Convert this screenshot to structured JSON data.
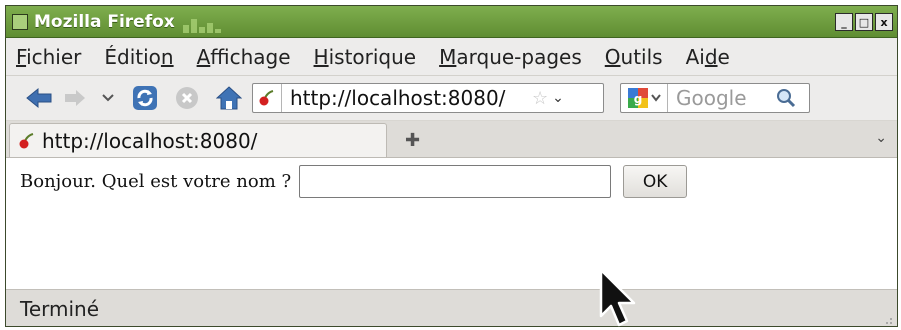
{
  "window": {
    "title": "Mozilla Firefox",
    "controls": [
      "_",
      "□",
      "x"
    ]
  },
  "menu": {
    "items": [
      {
        "pre": "",
        "u": "F",
        "post": "ichier"
      },
      {
        "pre": "Éditio",
        "u": "n",
        "post": ""
      },
      {
        "pre": "",
        "u": "A",
        "post": "ffichage"
      },
      {
        "pre": "",
        "u": "H",
        "post": "istorique"
      },
      {
        "pre": "",
        "u": "M",
        "post": "arque-pages"
      },
      {
        "pre": "",
        "u": "O",
        "post": "utils"
      },
      {
        "pre": "Ai",
        "u": "d",
        "post": "e"
      }
    ]
  },
  "toolbar": {
    "url": "http://localhost:8080/",
    "search_placeholder": "Google",
    "icons": [
      "back-arrow-icon",
      "forward-arrow-icon",
      "history-dropdown-icon",
      "reload-icon",
      "stop-icon",
      "home-icon",
      "bookmark-star-icon",
      "search-magnifier-icon"
    ]
  },
  "tabs": [
    {
      "label": "http://localhost:8080/",
      "active": true
    }
  ],
  "page": {
    "prompt": "Bonjour. Quel est votre nom ?",
    "input_value": "",
    "ok_label": "OK"
  },
  "status": {
    "text": "Terminé"
  },
  "colors": {
    "titlebar": "#6f9e40",
    "back_arrow": "#3f6fb0",
    "chrome": "#edeceb"
  }
}
